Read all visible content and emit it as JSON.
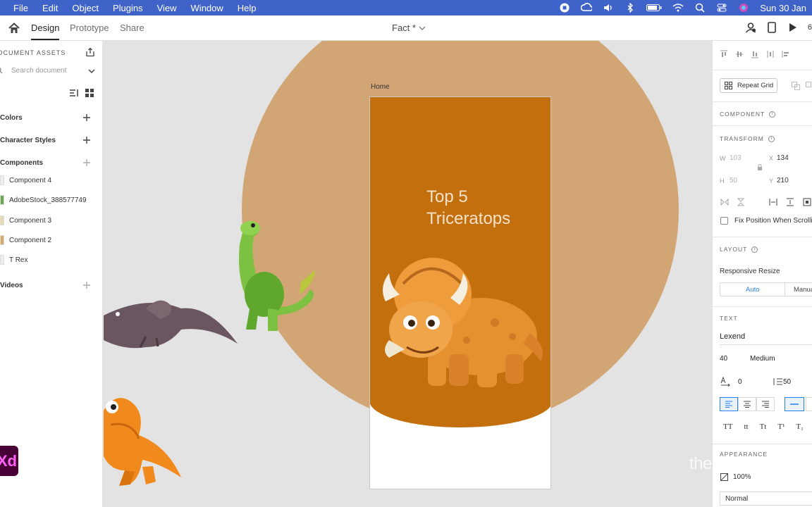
{
  "menubar": {
    "items": [
      "File",
      "Edit",
      "Object",
      "Plugins",
      "View",
      "Window",
      "Help"
    ],
    "clock": "Sun 30 Jan"
  },
  "toolbar": {
    "tabs": [
      "Design",
      "Prototype",
      "Share"
    ],
    "document_title": "Fact *",
    "zoom_partial": "6"
  },
  "assets": {
    "header": "DOCUMENT ASSETS",
    "search_placeholder": "Search document",
    "sections": {
      "colors": "Colors",
      "character_styles": "Character Styles",
      "components": "Components",
      "videos": "Videos"
    },
    "components": [
      "Component 4",
      "AdobeStock_388577749",
      "Component 3",
      "Component 2",
      "T Rex"
    ]
  },
  "canvas": {
    "artboard_name": "Home",
    "headline_line1": "Top 5",
    "headline_line2": "Triceratops"
  },
  "inspector": {
    "repeat_grid": "Repeat Grid",
    "component_label": "COMPONENT",
    "transform_label": "TRANSFORM",
    "w_label": "W",
    "w_value": "103",
    "h_label": "H",
    "h_value": "50",
    "x_label": "X",
    "x_value": "134",
    "y_label": "Y",
    "y_value": "210",
    "fix_position": "Fix Position When Scrolling",
    "layout_label": "LAYOUT",
    "responsive_resize": "Responsive Resize",
    "resize_auto": "Auto",
    "resize_manual": "Manual",
    "text_label": "TEXT",
    "font_family": "Lexend",
    "font_size": "40",
    "font_weight": "Medium",
    "char_spacing": "0",
    "line_spacing": "50",
    "text_case": [
      "TT",
      "tt",
      "Tt",
      "T¹",
      "T₁"
    ],
    "appearance_label": "APPEARANCE",
    "opacity": "100%",
    "blend_mode": "Normal"
  },
  "watermark": "theCreativeTech",
  "colors": {
    "menubar": "#3f63c9",
    "circle": "#d2a575",
    "artboard_orange": "#c46f0d",
    "headline": "#f4e2c8",
    "accent_blue": "#2680eb",
    "xd_badge": "#470137"
  }
}
